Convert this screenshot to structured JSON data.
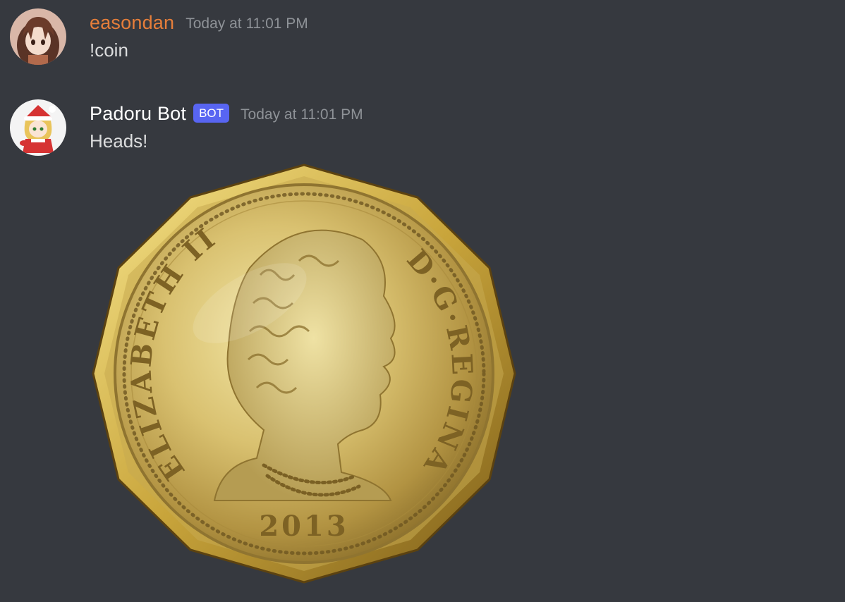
{
  "messages": [
    {
      "username": "easondan",
      "timestamp": "Today at 11:01 PM",
      "text": "!coin",
      "color": "#e67e3a"
    },
    {
      "username": "Padoru Bot",
      "badge": "BOT",
      "timestamp": "Today at 11:01 PM",
      "text": "Heads!",
      "attachment": {
        "type": "image",
        "description": "coin",
        "inscription_left": "ELIZABETH II",
        "inscription_right": "D·G·REGINA",
        "year": "2013"
      }
    }
  ],
  "colors": {
    "background": "#36393f",
    "bot_badge": "#5865f2",
    "timestamp": "#8e9297",
    "text": "#dcddde"
  }
}
